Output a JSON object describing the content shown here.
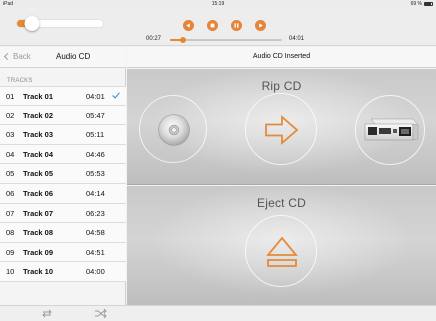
{
  "status_bar": {
    "device": "iPad",
    "time": "15:19",
    "battery": "69 %"
  },
  "player": {
    "elapsed": "00:27",
    "total": "04:01",
    "volume_level": 0.18,
    "progress_fraction": 0.112,
    "accent_color": "#e38a2e",
    "controls": [
      "rewind-icon",
      "stop-icon",
      "pause-icon",
      "fast-forward-icon"
    ]
  },
  "nav": {
    "back_label": "Back",
    "title": "Audio CD"
  },
  "tracks_header": "TRACKS",
  "tracks": [
    {
      "num": "01",
      "name": "Track 01",
      "duration": "04:01",
      "selected": true
    },
    {
      "num": "02",
      "name": "Track 02",
      "duration": "05:47",
      "selected": false
    },
    {
      "num": "03",
      "name": "Track 03",
      "duration": "05:11",
      "selected": false
    },
    {
      "num": "04",
      "name": "Track 04",
      "duration": "04:46",
      "selected": false
    },
    {
      "num": "05",
      "name": "Track 05",
      "duration": "05:53",
      "selected": false
    },
    {
      "num": "06",
      "name": "Track 06",
      "duration": "04:14",
      "selected": false
    },
    {
      "num": "07",
      "name": "Track 07",
      "duration": "06:23",
      "selected": false
    },
    {
      "num": "08",
      "name": "Track 08",
      "duration": "04:58",
      "selected": false
    },
    {
      "num": "09",
      "name": "Track 09",
      "duration": "04:51",
      "selected": false
    },
    {
      "num": "10",
      "name": "Track 10",
      "duration": "04:00",
      "selected": false
    }
  ],
  "main": {
    "header_title": "Audio CD Inserted",
    "rip_title": "Rip CD",
    "eject_title": "Eject CD",
    "icons": [
      "cd-icon",
      "arrow-right-icon",
      "music-server-icon",
      "eject-icon"
    ]
  },
  "bottom_bar": {
    "icons": [
      "repeat-icon",
      "shuffle-icon"
    ]
  }
}
